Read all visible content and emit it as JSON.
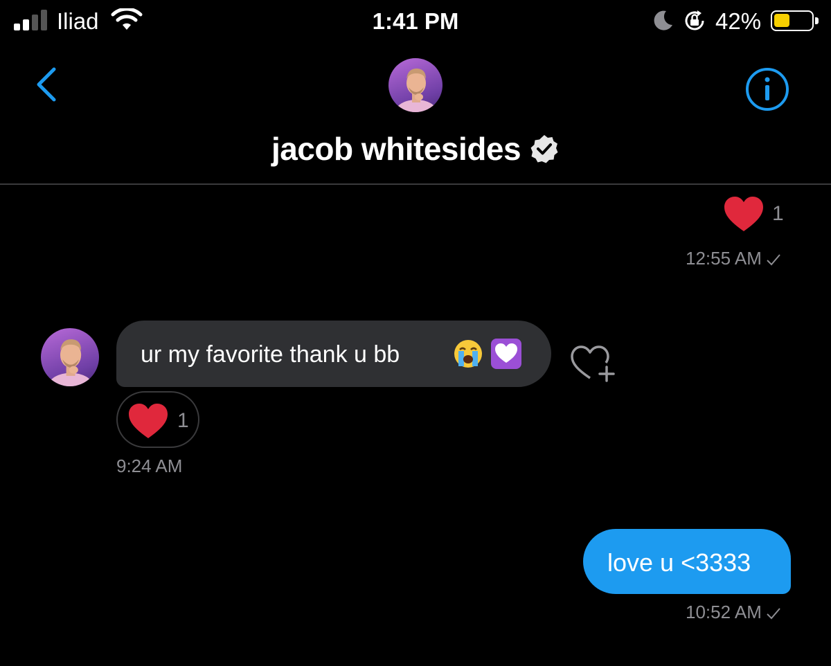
{
  "status_bar": {
    "carrier": "Iliad",
    "time": "1:41 PM",
    "battery_percent": "42%",
    "battery_level": 0.42,
    "icons": [
      "signal-icon",
      "wifi-icon",
      "moon-icon",
      "rotation-lock-icon",
      "battery-icon"
    ]
  },
  "header": {
    "contact_name": "jacob whitesides",
    "verified": true,
    "icons": [
      "back-chevron-icon",
      "info-icon",
      "verified-badge-icon"
    ]
  },
  "colors": {
    "accent": "#1d9bf0",
    "heart": "#e0283c",
    "received_bubble": "#2f3033",
    "timestamp": "#8e8e93"
  },
  "messages": [
    {
      "direction": "sent",
      "type": "heart-reaction",
      "count": "1",
      "timestamp": "12:55 AM",
      "read": true
    },
    {
      "direction": "received",
      "text": "ur my favorite thank u bb",
      "emojis": [
        "loudly-crying-face",
        "white-heart"
      ],
      "reaction_count": "1",
      "timestamp": "9:24 AM"
    },
    {
      "direction": "sent",
      "text": "love u <3333",
      "timestamp": "10:52 AM",
      "read": true
    }
  ]
}
